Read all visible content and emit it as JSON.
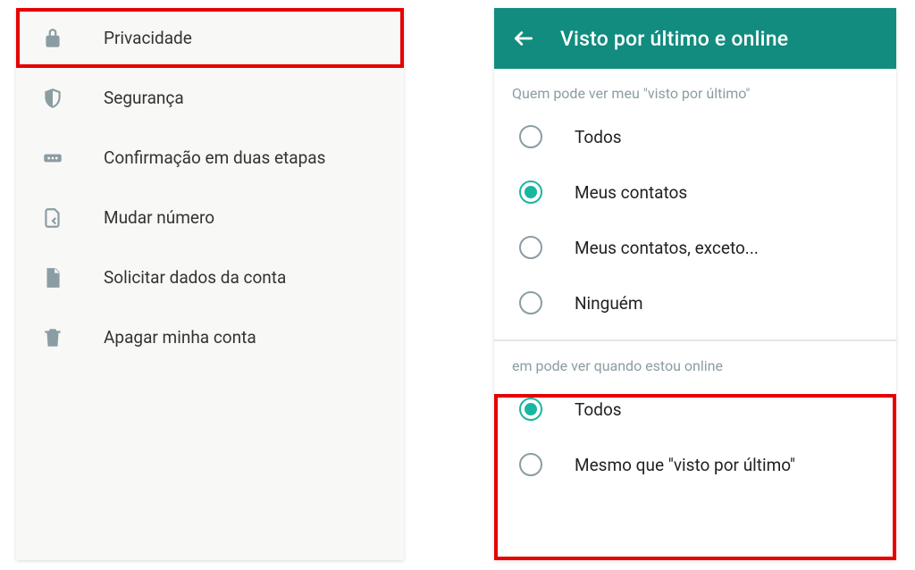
{
  "left": {
    "items": [
      {
        "label": "Privacidade",
        "icon": "lock"
      },
      {
        "label": "Segurança",
        "icon": "shield"
      },
      {
        "label": "Confirmação em duas etapas",
        "icon": "pin"
      },
      {
        "label": "Mudar número",
        "icon": "sim"
      },
      {
        "label": "Solicitar dados da conta",
        "icon": "document"
      },
      {
        "label": "Apagar minha conta",
        "icon": "trash"
      }
    ]
  },
  "right": {
    "appbar": {
      "title": "Visto por último e online"
    },
    "section1": {
      "header": "Quem pode ver meu \"visto por último\"",
      "options": [
        {
          "label": "Todos",
          "selected": false
        },
        {
          "label": "Meus contatos",
          "selected": true
        },
        {
          "label": "Meus contatos, exceto...",
          "selected": false
        },
        {
          "label": "Ninguém",
          "selected": false
        }
      ]
    },
    "section2": {
      "header": "em pode ver quando estou online",
      "options": [
        {
          "label": "Todos",
          "selected": true
        },
        {
          "label": "Mesmo que \"visto por último\"",
          "selected": false
        }
      ]
    }
  },
  "colors": {
    "accent": "#128c7e",
    "radio": "#1bb6a1",
    "icon": "#8a9da3",
    "highlight": "#e60000"
  }
}
